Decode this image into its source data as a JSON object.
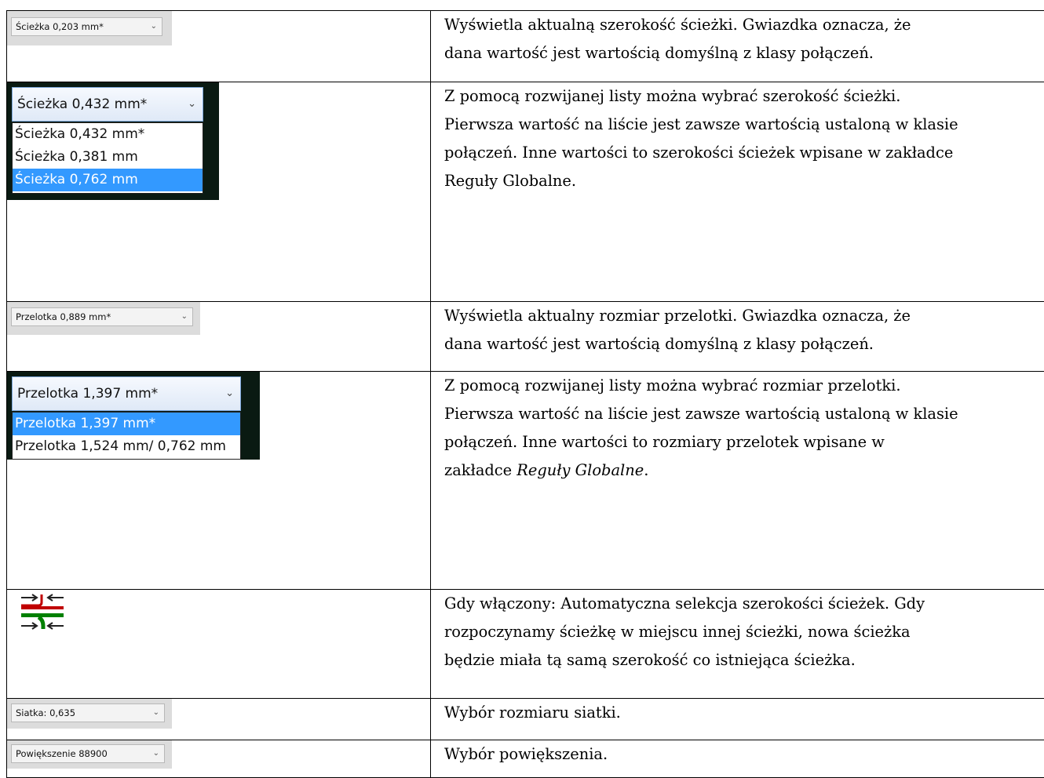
{
  "rows": [
    {
      "combo_label": "Ścieżka 0,203 mm*",
      "desc_lines": [
        "Wyświetla aktualną szerokość ścieżki. Gwiazdka oznacza, że",
        "dana wartość jest wartością domyślną z klasy połączeń."
      ]
    },
    {
      "combo_label": "Ścieżka 0,432 mm*",
      "dropdown_items": [
        "Ścieżka 0,432 mm*",
        "Ścieżka 0,381 mm",
        "Ścieżka 0,762 mm"
      ],
      "selected_index": 2,
      "desc_lines": [
        "Z pomocą rozwijanej listy można wybrać szerokość ścieżki.",
        "Pierwsza wartość na liście jest zawsze wartością ustaloną w klasie",
        "połączeń. Inne wartości to szerokości ścieżek wpisane w zakładce",
        "Reguły Globalne."
      ]
    },
    {
      "combo_label": "Przelotka 0,889 mm*",
      "desc_lines": [
        "Wyświetla aktualny rozmiar przelotki. Gwiazdka oznacza, że",
        "dana wartość jest wartością domyślną z klasy połączeń."
      ]
    },
    {
      "combo_label": "Przelotka 1,397 mm*",
      "dropdown_items": [
        "Przelotka 1,397 mm*",
        "Przelotka 1,524 mm/ 0,762 mm"
      ],
      "selected_index": 0,
      "desc_lines": [
        "Z pomocą rozwijanej listy można wybrać rozmiar przelotki.",
        "Pierwsza wartość na liście jest zawsze wartością ustaloną w klasie",
        "połączeń. Inne wartości to rozmiary przelotek wpisane w"
      ],
      "desc_last_prefix": "zakładce ",
      "desc_last_italic": "Reguły Globalne",
      "desc_last_suffix": "."
    },
    {
      "icon": "auto-track-width-icon",
      "desc_lines": [
        "Gdy włączony: Automatyczna selekcja szerokości ścieżek. Gdy",
        "rozpoczynamy ścieżkę w miejscu innej ścieżki, nowa ścieżka",
        "będzie miała tą samą szerokość co istniejąca ścieżka."
      ]
    },
    {
      "combo_label": "Siatka: 0,635",
      "desc_lines": [
        "Wybór rozmiaru siatki."
      ]
    },
    {
      "combo_label": "Powiększenie 88900",
      "desc_lines": [
        "Wybór powiększenia."
      ]
    }
  ],
  "colors": {
    "dropdown_selected": "#3399ff",
    "icon_red": "#c00000",
    "icon_green": "#008000"
  }
}
